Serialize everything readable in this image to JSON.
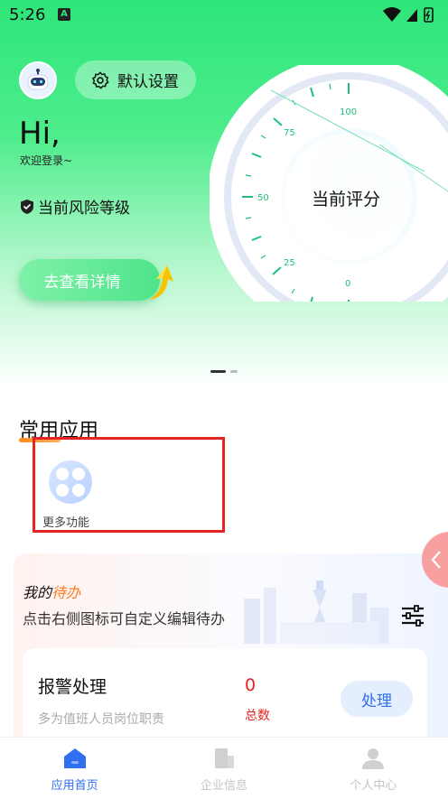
{
  "status_bar": {
    "time": "5:26",
    "notification_glyph": "A"
  },
  "header": {
    "settings_label": "默认设置",
    "greeting": "Hi,",
    "welcome": "欢迎登录~",
    "risk_label": "当前风险等级",
    "detail_button": "去查看详情"
  },
  "gauge": {
    "label": "当前评分",
    "ticks": [
      "100",
      "75",
      "50",
      "25",
      "0"
    ]
  },
  "apps": {
    "section_title": "常用应用",
    "items": [
      {
        "label": "更多功能",
        "icon": "grid-four-dots-icon"
      }
    ]
  },
  "todo": {
    "title_prefix": "我的",
    "title_accent": "待办",
    "description": "点击右侧图标可自定义编辑待办",
    "alarm": {
      "title": "报警处理",
      "subtitle": "多为值班人员岗位职责",
      "count": "0",
      "count_label": "总数",
      "action": "处理"
    }
  },
  "bottom_nav": [
    {
      "label": "应用首页",
      "icon": "home-icon",
      "active": true
    },
    {
      "label": "企业信息",
      "icon": "building-icon",
      "active": false
    },
    {
      "label": "个人中心",
      "icon": "person-icon",
      "active": false
    }
  ],
  "colors": {
    "brand_green": "#2ee57a",
    "accent_orange": "#ff7a1a",
    "primary_blue": "#2f6ff0",
    "alert_red": "#e52323"
  }
}
